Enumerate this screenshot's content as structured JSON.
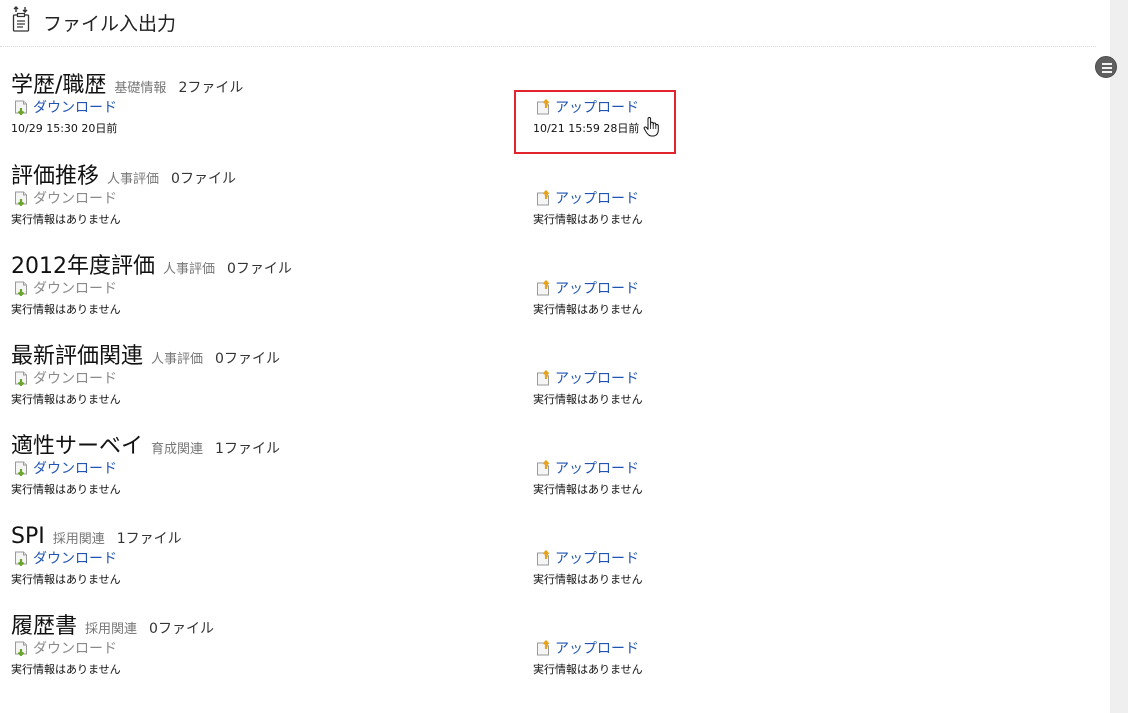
{
  "page": {
    "title": "ファイル入出力",
    "title_icon": "clipboard-arrows-icon"
  },
  "labels": {
    "download": "ダウンロード",
    "upload": "アップロード",
    "no_info": "実行情報はありません"
  },
  "sections": [
    {
      "name": "学歴/職歴",
      "category": "基礎情報",
      "count": "2ファイル",
      "download_enabled": true,
      "download_info": "10/29 15:30 20日前",
      "upload_info": "10/21 15:59 28日前"
    },
    {
      "name": "評価推移",
      "category": "人事評価",
      "count": "0ファイル",
      "download_enabled": false,
      "download_info": "実行情報はありません",
      "upload_info": "実行情報はありません"
    },
    {
      "name": "2012年度評価",
      "category": "人事評価",
      "count": "0ファイル",
      "download_enabled": false,
      "download_info": "実行情報はありません",
      "upload_info": "実行情報はありません"
    },
    {
      "name": "最新評価関連",
      "category": "人事評価",
      "count": "0ファイル",
      "download_enabled": false,
      "download_info": "実行情報はありません",
      "upload_info": "実行情報はありません"
    },
    {
      "name": "適性サーベイ",
      "category": "育成関連",
      "count": "1ファイル",
      "download_enabled": true,
      "download_info": "実行情報はありません",
      "upload_info": "実行情報はありません"
    },
    {
      "name": "SPI",
      "category": "採用関連",
      "count": "1ファイル",
      "download_enabled": true,
      "download_info": "実行情報はありません",
      "upload_info": "実行情報はありません"
    },
    {
      "name": "履歴書",
      "category": "採用関連",
      "count": "0ファイル",
      "download_enabled": false,
      "download_info": "実行情報はありません",
      "upload_info": "実行情報はありません"
    }
  ],
  "colors": {
    "link": "#2255b3",
    "link_disabled": "#8a8a8a",
    "highlight": "#e2242f"
  }
}
